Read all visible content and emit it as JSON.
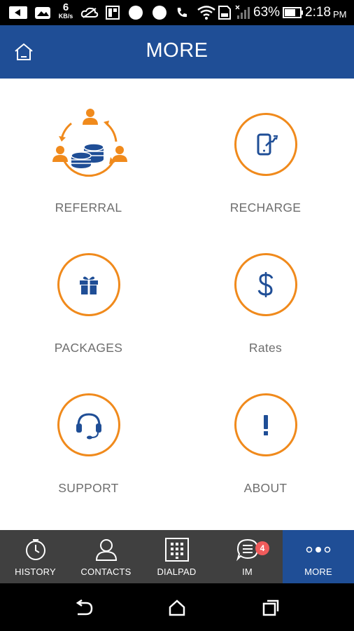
{
  "status_bar": {
    "net_speed_value": "6",
    "net_speed_unit": "KB/s",
    "battery_percent": "63%",
    "time": "2:18",
    "time_suffix": "PM"
  },
  "header": {
    "title": "MORE"
  },
  "menu": [
    {
      "label": "REFERRAL",
      "icon": "referral-coins-icon"
    },
    {
      "label": "RECHARGE",
      "icon": "phone-recharge-icon"
    },
    {
      "label": "PACKAGES",
      "icon": "gift-icon"
    },
    {
      "label": "Rates",
      "icon": "dollar-icon"
    },
    {
      "label": "SUPPORT",
      "icon": "headset-icon"
    },
    {
      "label": "ABOUT",
      "icon": "exclamation-icon"
    }
  ],
  "bottom_nav": {
    "active": "MORE",
    "items": [
      {
        "label": "HISTORY",
        "icon": "clock-icon"
      },
      {
        "label": "CONTACTS",
        "icon": "person-icon"
      },
      {
        "label": "DIALPAD",
        "icon": "dialpad-icon"
      },
      {
        "label": "IM",
        "icon": "chat-list-icon",
        "badge": "4"
      },
      {
        "label": "MORE",
        "icon": "more-dots-icon"
      }
    ]
  },
  "colors": {
    "header_bg": "#1f4e96",
    "accent_orange": "#f08a1c",
    "icon_blue": "#1f4e96",
    "label_gray": "#6e6e6e",
    "bottom_nav_bg": "#404040",
    "badge_red": "#f05b5b"
  }
}
